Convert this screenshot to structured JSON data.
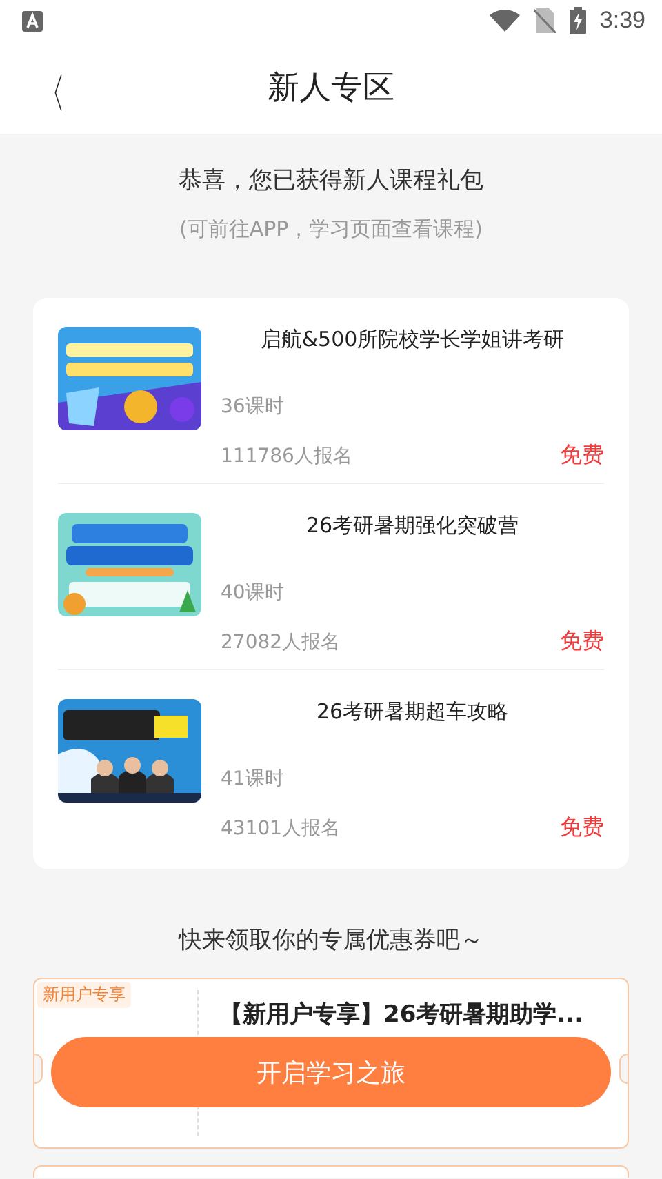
{
  "status_bar": {
    "time": "3:39"
  },
  "header": {
    "back": "〈",
    "title": "新人专区"
  },
  "intro": {
    "headline": "恭喜，您已获得新人课程礼包",
    "note": "(可前往APP，学习页面查看课程)"
  },
  "courses": [
    {
      "kind": "picture",
      "title": "启航&500所院校学长学姐讲考研",
      "lessons": "36课时",
      "enrolled": "111786人报名",
      "price": "免费"
    },
    {
      "kind": "picture",
      "title": "26考研暑期强化突破营",
      "lessons": "40课时",
      "enrolled": "27082人报名",
      "price": "免费"
    },
    {
      "kind": "picture",
      "title": "26考研暑期超车攻略",
      "lessons": "41课时",
      "enrolled": "43101人报名",
      "price": "免费"
    }
  ],
  "coupons": {
    "heading": "快来领取你的专属优惠券吧～",
    "items": [
      {
        "tag": "新用户专享",
        "title": "【新用户专享】26考研暑期助学..."
      }
    ]
  },
  "cta": {
    "label": "开启学习之旅"
  }
}
